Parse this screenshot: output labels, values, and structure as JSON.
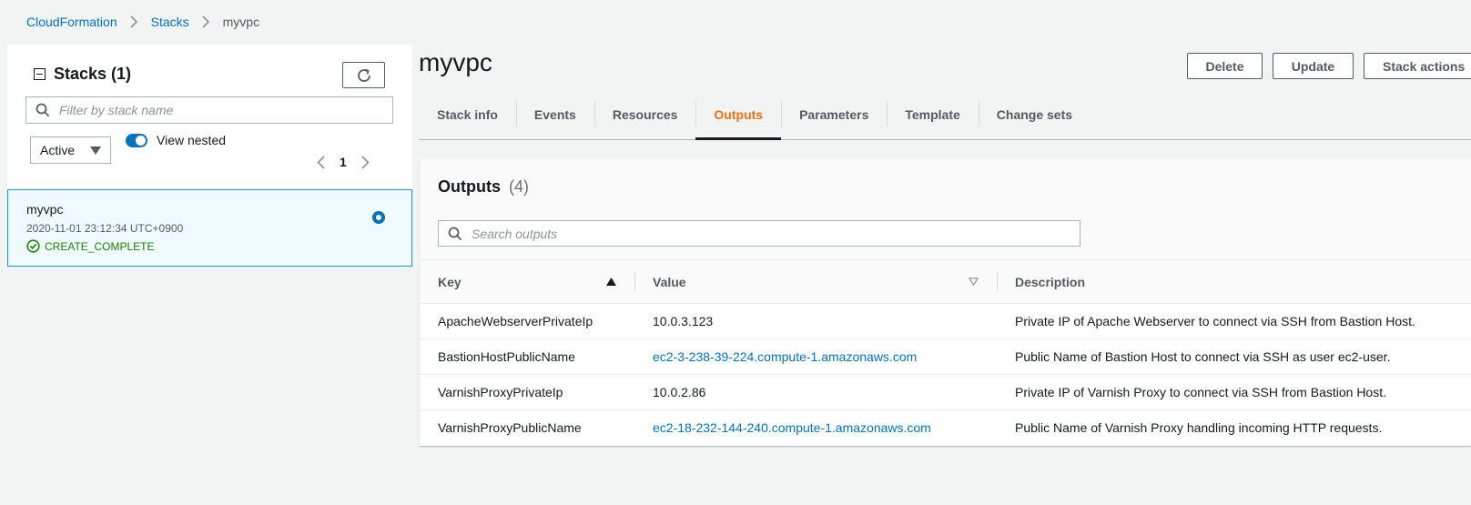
{
  "breadcrumb": {
    "root": "CloudFormation",
    "stacks": "Stacks",
    "current": "myvpc"
  },
  "sidebar": {
    "title": "Stacks",
    "count": "(1)",
    "filter_placeholder": "Filter by stack name",
    "status_filter": "Active",
    "toggle_label": "View nested",
    "page": "1",
    "stacks": [
      {
        "name": "myvpc",
        "time": "2020-11-01 23:12:34 UTC+0900",
        "status": "CREATE_COMPLETE"
      }
    ]
  },
  "main": {
    "title": "myvpc",
    "actions": {
      "delete": "Delete",
      "update": "Update",
      "stack_actions": "Stack actions"
    },
    "tabs": [
      {
        "label": "Stack info"
      },
      {
        "label": "Events"
      },
      {
        "label": "Resources"
      },
      {
        "label": "Outputs"
      },
      {
        "label": "Parameters"
      },
      {
        "label": "Template"
      },
      {
        "label": "Change sets"
      }
    ],
    "active_tab": "Outputs",
    "outputs": {
      "title": "Outputs",
      "count": "(4)",
      "search_placeholder": "Search outputs",
      "columns": {
        "key": "Key",
        "value": "Value",
        "description": "Description"
      },
      "rows": [
        {
          "key": "ApacheWebserverPrivateIp",
          "value": "10.0.3.123",
          "value_is_link": false,
          "description": "Private IP of Apache Webserver to connect via SSH from Bastion Host."
        },
        {
          "key": "BastionHostPublicName",
          "value": "ec2-3-238-39-224.compute-1.amazonaws.com",
          "value_is_link": true,
          "description": "Public Name of Bastion Host to connect via SSH as user ec2-user."
        },
        {
          "key": "VarnishProxyPrivateIp",
          "value": "10.0.2.86",
          "value_is_link": false,
          "description": "Private IP of Varnish Proxy to connect via SSH from Bastion Host."
        },
        {
          "key": "VarnishProxyPublicName",
          "value": "ec2-18-232-144-240.compute-1.amazonaws.com",
          "value_is_link": true,
          "description": "Public Name of Varnish Proxy handling incoming HTTP requests."
        }
      ]
    }
  },
  "colors": {
    "link": "#0073bb",
    "active_tab": "#ec7211",
    "success": "#1d8102",
    "selected_bg": "#f1faff"
  }
}
